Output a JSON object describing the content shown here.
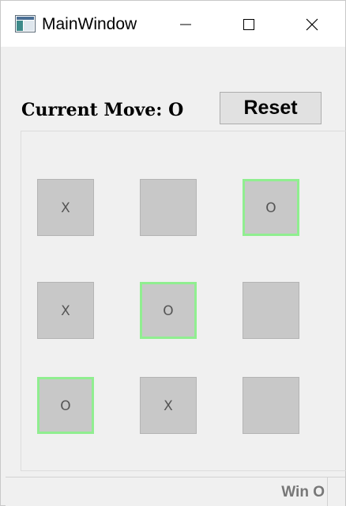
{
  "window": {
    "title": "MainWindow",
    "icon": "app-window-icon"
  },
  "titlebar_controls": [
    {
      "name": "minimize",
      "icon": "minimize-icon"
    },
    {
      "name": "maximize",
      "icon": "maximize-icon"
    },
    {
      "name": "close",
      "icon": "close-icon"
    }
  ],
  "game": {
    "current_move_label": "Current Move: O",
    "reset_label": "Reset",
    "board": [
      [
        {
          "mark": "X",
          "highlight": false
        },
        {
          "mark": "",
          "highlight": false
        },
        {
          "mark": "O",
          "highlight": true
        }
      ],
      [
        {
          "mark": "X",
          "highlight": false
        },
        {
          "mark": "O",
          "highlight": true
        },
        {
          "mark": "",
          "highlight": false
        }
      ],
      [
        {
          "mark": "O",
          "highlight": true
        },
        {
          "mark": "X",
          "highlight": false
        },
        {
          "mark": "",
          "highlight": false
        }
      ]
    ],
    "highlight_color": "#90ee90"
  },
  "status": {
    "text": "Win O"
  }
}
